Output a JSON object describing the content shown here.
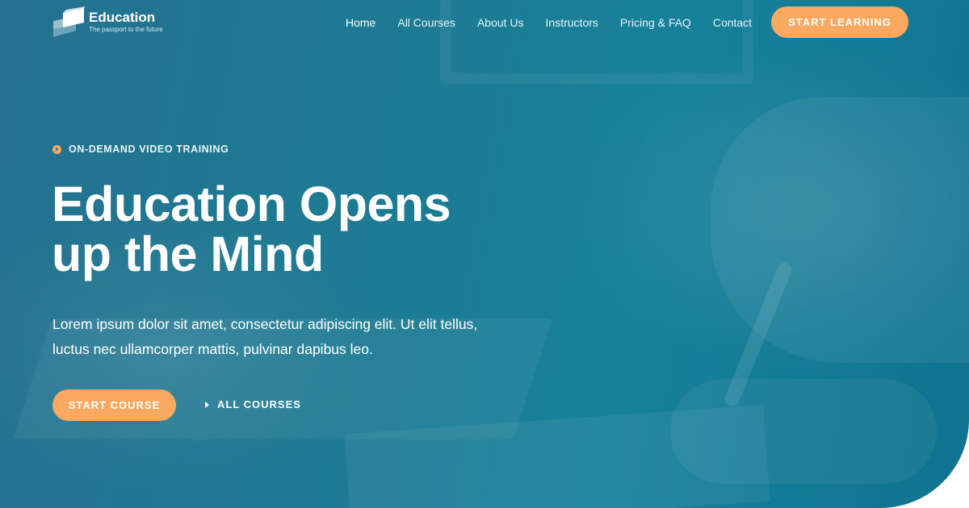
{
  "brand": {
    "name": "Education",
    "tagline": "The passport to the future",
    "logo_icon": "book-stack-icon"
  },
  "nav": {
    "items": [
      {
        "label": "Home",
        "active": true
      },
      {
        "label": "All Courses",
        "active": false
      },
      {
        "label": "About Us",
        "active": false
      },
      {
        "label": "Instructors",
        "active": false
      },
      {
        "label": "Pricing & FAQ",
        "active": false
      },
      {
        "label": "Contact",
        "active": false
      }
    ],
    "cta_label": "START LEARNING"
  },
  "hero": {
    "eyebrow_icon": "play-circle-icon",
    "eyebrow": "ON-DEMAND VIDEO TRAINING",
    "headline_line1": "Education Opens",
    "headline_line2": "up the Mind",
    "lead_line1": "Lorem ipsum dolor sit amet, consectetur adipiscing elit. Ut elit tellus,",
    "lead_line2": "luctus nec ullamcorper mattis, pulvinar dapibus leo.",
    "primary_button": "START COURSE",
    "secondary_icon": "caret-right-icon",
    "secondary_link": "ALL COURSES"
  },
  "colors": {
    "accent": "#fba960",
    "overlay_teal": "#1d7b93",
    "text_light": "#ffffff"
  }
}
